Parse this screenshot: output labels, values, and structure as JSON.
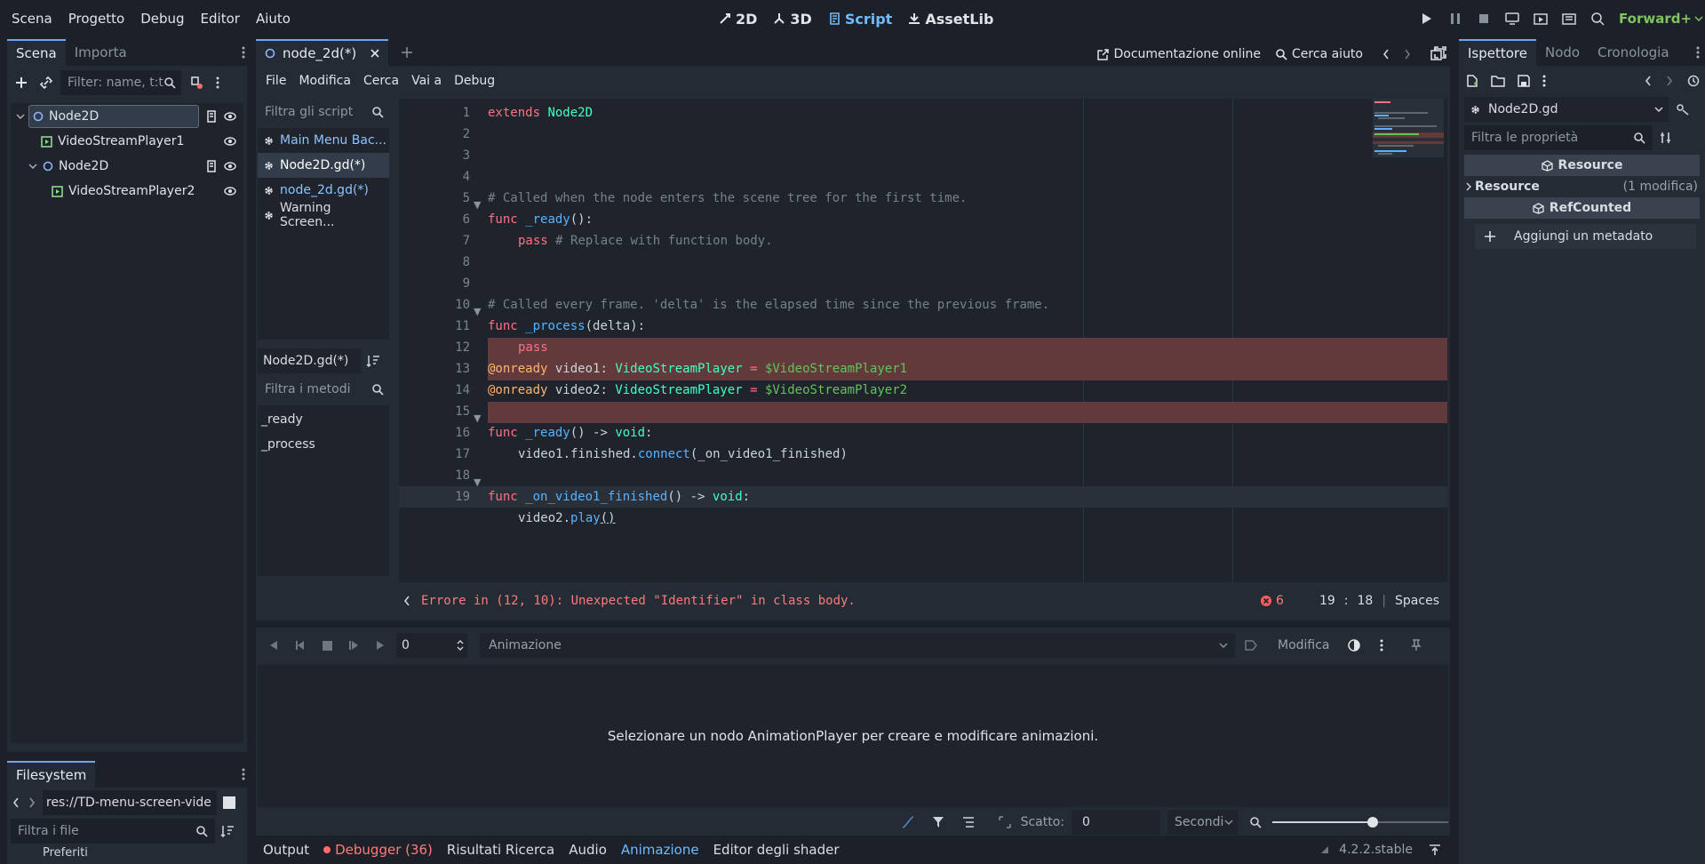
{
  "menubar": {
    "items": [
      "Scena",
      "Progetto",
      "Debug",
      "Editor",
      "Aiuto"
    ]
  },
  "modes": [
    {
      "label": "2D",
      "icon": "2d-icon",
      "active": false
    },
    {
      "label": "3D",
      "icon": "3d-icon",
      "active": false
    },
    {
      "label": "Script",
      "icon": "script-icon",
      "active": true
    },
    {
      "label": "AssetLib",
      "icon": "assetlib-icon",
      "active": false
    }
  ],
  "run": {
    "renderer": "Forward+"
  },
  "left_dock": {
    "tabs": [
      "Scena",
      "Importa"
    ],
    "filter_placeholder": "Filter: name, t:t",
    "tree": [
      {
        "label": "Node2D",
        "type": "node2d",
        "depth": 0
      },
      {
        "label": "VideoStreamPlayer1",
        "type": "video",
        "depth": 1
      },
      {
        "label": "Node2D",
        "type": "node2d",
        "depth": 1
      },
      {
        "label": "VideoStreamPlayer2",
        "type": "video",
        "depth": 2
      }
    ]
  },
  "filesystem": {
    "tab": "Filesystem",
    "path": "res://TD-menu-screen-vide",
    "filter_placeholder": "Filtra i file",
    "partial_item": "Preferiti"
  },
  "editor_tabs": {
    "active_tab": "node_2d(*)"
  },
  "script_menu": {
    "items": [
      "File",
      "Modifica",
      "Cerca",
      "Vai a",
      "Debug"
    ],
    "online_docs": "Documentazione online",
    "search_help": "Cerca aiuto"
  },
  "scripts": {
    "filter_placeholder": "Filtra gli script",
    "items": [
      "Main Menu Bac...",
      "Node2D.gd(*)",
      "node_2d.gd(*)",
      "Warning Screen..."
    ],
    "current": "Node2D.gd(*)",
    "methods_placeholder": "Filtra i metodi",
    "methods": [
      "_ready",
      "_process"
    ]
  },
  "code": {
    "lines": [
      "1",
      "2",
      "3",
      "4",
      "5",
      "6",
      "7",
      "8",
      "9",
      "10",
      "11",
      "12",
      "13",
      "14",
      "15",
      "16",
      "17",
      "18",
      "19"
    ],
    "l1_kw": "extends",
    "l1_type": "Node2D",
    "l4": "# Called when the node enters the scene tree for the first time.",
    "l5_kw": "func",
    "l5_fn": "_ready",
    "l5_rest": "():",
    "l6_kw": "pass",
    "l6_cm": "# Replace with function body.",
    "l9": "# Called every frame. 'delta' is the elapsed time since the previous frame.",
    "l10_kw": "func",
    "l10_fn": "_process",
    "l10_rest": "(delta):",
    "l11_kw": "pass",
    "l12_an": "@onready",
    "l12_var": "video1:",
    "l12_type": "VideoStreamPlayer",
    "l12_eq": "=",
    "l12_np": "$VideoStreamPlayer1",
    "l13_an": "@onready",
    "l13_var": "video2:",
    "l13_type": "VideoStreamPlayer",
    "l13_eq": "=",
    "l13_np": "$VideoStreamPlayer2",
    "l15_kw": "func",
    "l15_fn": "_ready",
    "l15_rest": "() ->",
    "l15_type": "void",
    "l16_a": "video1.finished.",
    "l16_fn": "connect",
    "l16_b": "(_on_video1_finished)",
    "l18_kw": "func",
    "l18_fn": "_on_video1_finished",
    "l18_rest": "() ->",
    "l18_type": "void",
    "l19_a": "video2.",
    "l19_fn": "play",
    "l19_b": "()"
  },
  "status": {
    "error": "Errore in (12, 10): Unexpected \"Identifier\" in class body.",
    "error_count": "6",
    "line": "19",
    "col": "18",
    "indent": "Spaces"
  },
  "animation": {
    "frame_value": "0",
    "label": "Animazione",
    "edit": "Modifica",
    "empty_message": "Selezionare un nodo AnimationPlayer per creare e modificare animazioni.",
    "snap_label": "Scatto:",
    "snap_value": "0",
    "unit": "Secondi",
    "zoom_value": 0.57
  },
  "bottom_tabs": {
    "items": [
      "Output",
      "Debugger (36)",
      "Risultati Ricerca",
      "Audio",
      "Animazione",
      "Editor degli shader"
    ],
    "active": "Animazione",
    "version": "4.2.2.stable"
  },
  "inspector": {
    "tabs": [
      "Ispettore",
      "Nodo",
      "Cronologia"
    ],
    "object": "Node2D.gd",
    "filter_placeholder": "Filtra le proprietà",
    "resource_header": "Resource",
    "resource_label": "Resource",
    "resource_count": "(1 modifica)",
    "refcounted_header": "RefCounted",
    "add_metadata": "Aggiungi un metadato"
  },
  "colors": {
    "accent": "#70baff",
    "error_bg": "#633a3b",
    "error_text": "#ff7a7a",
    "renderer": "#7fc45e"
  }
}
